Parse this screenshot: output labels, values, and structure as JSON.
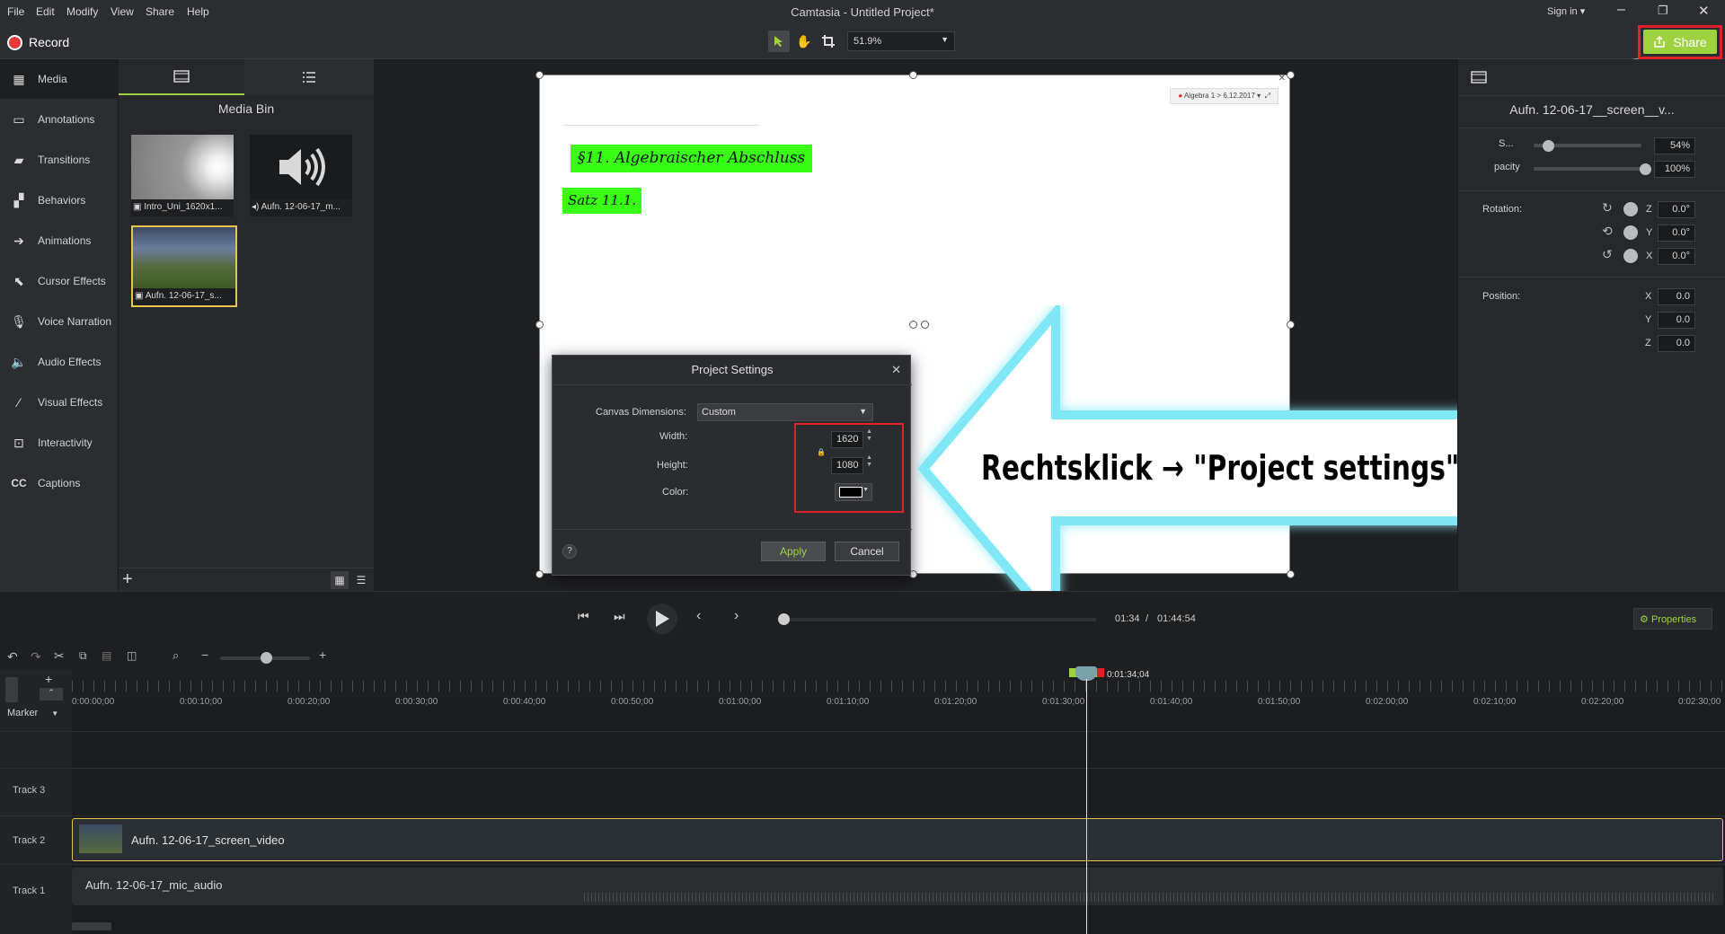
{
  "menu": {
    "file": "File",
    "edit": "Edit",
    "modify": "Modify",
    "view": "View",
    "share": "Share",
    "help": "Help"
  },
  "window_title": "Camtasia - Untitled Project*",
  "signin": "Sign in",
  "toolbar": {
    "record": "Record",
    "zoom": "51.9%",
    "share": "Share"
  },
  "tools": [
    {
      "label": "Media",
      "icon": "film-icon"
    },
    {
      "label": "Annotations",
      "icon": "annotation-icon"
    },
    {
      "label": "Transitions",
      "icon": "transition-icon"
    },
    {
      "label": "Behaviors",
      "icon": "behavior-icon"
    },
    {
      "label": "Animations",
      "icon": "animation-icon"
    },
    {
      "label": "Cursor Effects",
      "icon": "cursor-icon"
    },
    {
      "label": "Voice Narration",
      "icon": "microphone-icon"
    },
    {
      "label": "Audio Effects",
      "icon": "speaker-icon"
    },
    {
      "label": "Visual Effects",
      "icon": "wand-icon"
    },
    {
      "label": "Interactivity",
      "icon": "interactivity-icon"
    },
    {
      "label": "Captions",
      "icon": "cc-icon"
    }
  ],
  "mediabin": {
    "title": "Media Bin",
    "items": [
      {
        "label": "Intro_Uni_1620x1..."
      },
      {
        "label": "Aufn. 12-06-17_m..."
      },
      {
        "label": "Aufn. 12-06-17_s..."
      }
    ]
  },
  "canvas": {
    "chip": "Algebra 1 > 6.12.2017",
    "line1": "§11. Algebraischer Abschluss",
    "line2": "Satz 11.1."
  },
  "dialog": {
    "title": "Project Settings",
    "canvas_dimensions_label": "Canvas Dimensions:",
    "canvas_dimensions_value": "Custom",
    "width_label": "Width:",
    "width_value": "1620",
    "height_label": "Height:",
    "height_value": "1080",
    "color_label": "Color:",
    "help": "?",
    "apply": "Apply",
    "cancel": "Cancel"
  },
  "annotation": {
    "text": "Rechtsklick → \"Project settings\""
  },
  "properties": {
    "clip_title": "Aufn. 12-06-17__screen__v...",
    "scale_label": "S...",
    "scale_value": "54%",
    "opacity_label": "pacity",
    "opacity_value": "100%",
    "rotation_label": "Rotation:",
    "rot_z_label": "Z",
    "rot_z": "0.0°",
    "rot_y_label": "Y",
    "rot_y": "0.0°",
    "rot_x_label": "X",
    "rot_x": "0.0°",
    "position_label": "Position:",
    "pos_x_label": "X",
    "pos_x": "0.0",
    "pos_y_label": "Y",
    "pos_y": "0.0",
    "pos_z_label": "Z",
    "pos_z": "0.0",
    "button": "Properties"
  },
  "player": {
    "current": "01:34",
    "separator": "/",
    "total": "01:44:54"
  },
  "timeline": {
    "playhead_time": "0:01:34;04",
    "marker": "Marker",
    "ruler": [
      "0:00:00;00",
      "0:00:10;00",
      "0:00:20;00",
      "0:00:30;00",
      "0:00:40;00",
      "0:00:50;00",
      "0:01:00;00",
      "0:01:10;00",
      "0:01:20;00",
      "0:01:30;00",
      "0:01:40;00",
      "0:01:50;00",
      "0:02:00;00",
      "0:02:10;00",
      "0:02:20;00",
      "0:02:30;00"
    ],
    "tracks": [
      {
        "label": "Track 3"
      },
      {
        "label": "Track 2",
        "clip": "Aufn. 12-06-17_screen_video"
      },
      {
        "label": "Track 1",
        "clip": "Aufn. 12-06-17_mic_audio"
      }
    ]
  },
  "colors": {
    "accent": "#9ed33f",
    "highlight_box": "#e1202a",
    "arrow_glow": "#7fe7f5"
  }
}
